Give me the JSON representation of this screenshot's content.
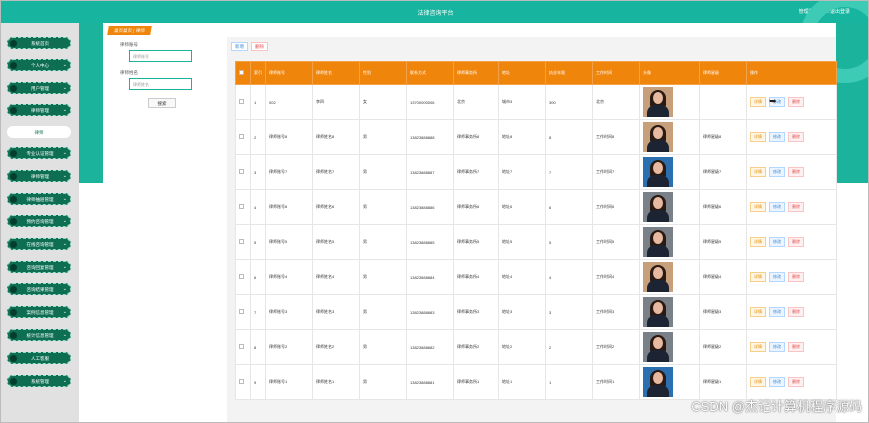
{
  "header": {
    "title": "法律咨询平台",
    "user": "管理员 admin  退出登录"
  },
  "colors": {
    "primary": "#17b59f",
    "accent": "#f0850b",
    "sidebar": "#0e6e52"
  },
  "sidebar": {
    "items": [
      {
        "label": "系统首页",
        "icon": "home-icon",
        "active": false,
        "expand": false
      },
      {
        "label": "个人中心",
        "icon": "person-icon",
        "active": false,
        "expand": true
      },
      {
        "label": "用户管理",
        "icon": "users-icon",
        "active": false,
        "expand": true
      },
      {
        "label": "律师管理",
        "icon": "lawyer-icon",
        "active": false,
        "expand": true
      },
      {
        "label": "律师",
        "icon": "",
        "active": true,
        "expand": false
      },
      {
        "label": "专业认证管理",
        "icon": "badge-icon",
        "active": false,
        "expand": true
      },
      {
        "label": "律师管理",
        "icon": "lawyer-icon",
        "active": false,
        "expand": true
      },
      {
        "label": "律师抽屉管理",
        "icon": "folder-icon",
        "active": false,
        "expand": true
      },
      {
        "label": "预约咨询管理",
        "icon": "calendar-icon",
        "active": false,
        "expand": true
      },
      {
        "label": "在线咨询管理",
        "icon": "chat-icon",
        "active": false,
        "expand": true
      },
      {
        "label": "咨询回复管理",
        "icon": "reply-icon",
        "active": false,
        "expand": true
      },
      {
        "label": "咨询结果管理",
        "icon": "result-icon",
        "active": false,
        "expand": true
      },
      {
        "label": "案例信息管理",
        "icon": "case-icon",
        "active": false,
        "expand": true
      },
      {
        "label": "统计信息管理",
        "icon": "stats-icon",
        "active": false,
        "expand": true
      },
      {
        "label": "人工客服",
        "icon": "service-icon",
        "active": false,
        "expand": false
      },
      {
        "label": "系统管理",
        "icon": "settings-icon",
        "active": false,
        "expand": true
      }
    ]
  },
  "breadcrumb": {
    "home": "首页首页",
    "sep": "|",
    "current": "律师"
  },
  "filter": {
    "lawyer_no_label": "律师账号",
    "lawyer_no_placeholder": "律师账号",
    "lawyer_name_label": "律师姓名",
    "lawyer_name_placeholder": "律师姓名",
    "search_label": "搜索"
  },
  "toolbar": {
    "add_label": "新增",
    "delete_label": "删除"
  },
  "table": {
    "headers": [
      "",
      "索引",
      "律师账号",
      "律师姓名",
      "性别",
      "联系方式",
      "律师事务所",
      "地址",
      "执业年限",
      "工作时间",
      "头像",
      "律师星级",
      "操作"
    ],
    "ops": {
      "detail": "详情",
      "edit": "修改",
      "remove": "删除"
    },
    "rows": [
      {
        "idx": "1",
        "no": "002",
        "name": "李四",
        "gender": "女",
        "phone": "13700000006",
        "firm": "北京",
        "addr": "城市3",
        "years": "300",
        "time": "北京",
        "photo": "warm",
        "star": ""
      },
      {
        "idx": "2",
        "no": "律师账号8",
        "name": "律师姓名8",
        "gender": "男",
        "phone": "13823888888",
        "firm": "律师事务所8",
        "addr": "地址8",
        "years": "8",
        "time": "工作时间8",
        "photo": "warm",
        "star": "律师星级8"
      },
      {
        "idx": "3",
        "no": "律师账号7",
        "name": "律师姓名7",
        "gender": "男",
        "phone": "13823888887",
        "firm": "律师事务所7",
        "addr": "地址7",
        "years": "7",
        "time": "工作时间7",
        "photo": "blue",
        "star": "律师星级7"
      },
      {
        "idx": "4",
        "no": "律师账号6",
        "name": "律师姓名6",
        "gender": "男",
        "phone": "13823888886",
        "firm": "律师事务所6",
        "addr": "地址6",
        "years": "6",
        "time": "工作时间6",
        "photo": "grey",
        "star": "律师星级6"
      },
      {
        "idx": "5",
        "no": "律师账号5",
        "name": "律师姓名5",
        "gender": "男",
        "phone": "13823888885",
        "firm": "律师事务所5",
        "addr": "地址5",
        "years": "5",
        "time": "工作时间5",
        "photo": "grey",
        "star": "律师星级5"
      },
      {
        "idx": "6",
        "no": "律师账号4",
        "name": "律师姓名4",
        "gender": "男",
        "phone": "13823888884",
        "firm": "律师事务所4",
        "addr": "地址4",
        "years": "4",
        "time": "工作时间4",
        "photo": "warm",
        "star": "律师星级4"
      },
      {
        "idx": "7",
        "no": "律师账号3",
        "name": "律师姓名3",
        "gender": "男",
        "phone": "13823888883",
        "firm": "律师事务所3",
        "addr": "地址3",
        "years": "3",
        "time": "工作时间3",
        "photo": "grey",
        "star": "律师星级3"
      },
      {
        "idx": "8",
        "no": "律师账号2",
        "name": "律师姓名2",
        "gender": "男",
        "phone": "13823888882",
        "firm": "律师事务所2",
        "addr": "地址2",
        "years": "2",
        "time": "工作时间2",
        "photo": "grey",
        "star": "律师星级2"
      },
      {
        "idx": "9",
        "no": "律师账号1",
        "name": "律师姓名1",
        "gender": "男",
        "phone": "13823888881",
        "firm": "律师事务所1",
        "addr": "地址1",
        "years": "1",
        "time": "工作时间1",
        "photo": "blue",
        "star": "律师星级1"
      }
    ]
  },
  "watermark": "CSDN @杰记计算机程序源码"
}
